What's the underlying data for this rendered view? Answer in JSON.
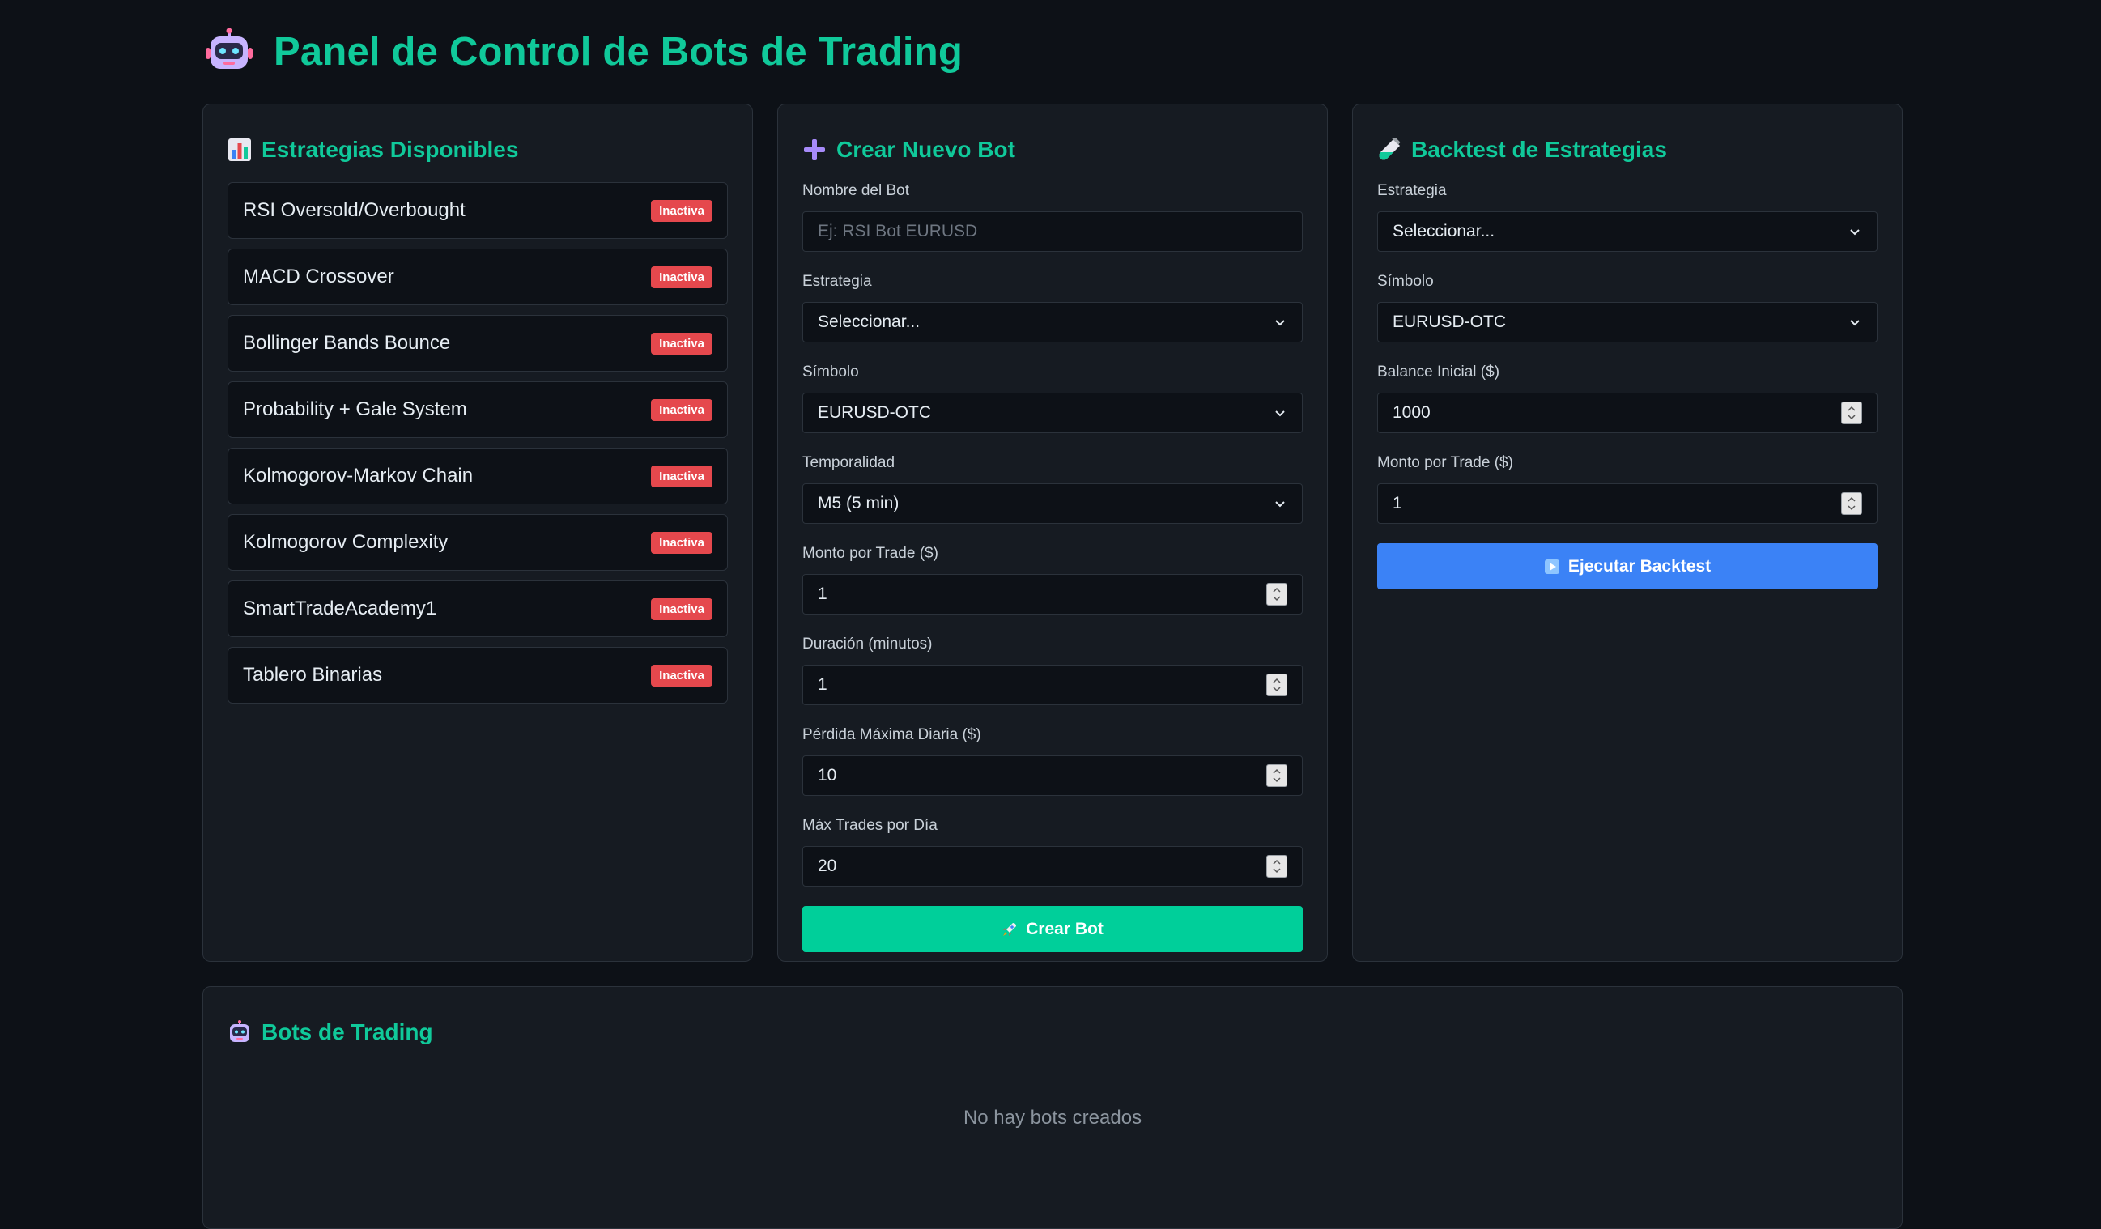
{
  "header": {
    "title": "Panel de Control de Bots de Trading",
    "icon": "robot-icon"
  },
  "strategies": {
    "title": "Estrategias Disponibles",
    "icon": "bar-chart-icon",
    "items": [
      {
        "name": "RSI Oversold/Overbought",
        "status": "Inactiva"
      },
      {
        "name": "MACD Crossover",
        "status": "Inactiva"
      },
      {
        "name": "Bollinger Bands Bounce",
        "status": "Inactiva"
      },
      {
        "name": "Probability + Gale System",
        "status": "Inactiva"
      },
      {
        "name": "Kolmogorov-Markov Chain",
        "status": "Inactiva"
      },
      {
        "name": "Kolmogorov Complexity",
        "status": "Inactiva"
      },
      {
        "name": "SmartTradeAcademy1",
        "status": "Inactiva"
      },
      {
        "name": "Tablero Binarias",
        "status": "Inactiva"
      }
    ]
  },
  "create": {
    "title": "Crear Nuevo Bot",
    "icon": "plus-icon",
    "name_label": "Nombre del Bot",
    "name_placeholder": "Ej: RSI Bot EURUSD",
    "strategy_label": "Estrategia",
    "strategy_value": "Seleccionar...",
    "symbol_label": "Símbolo",
    "symbol_value": "EURUSD-OTC",
    "timeframe_label": "Temporalidad",
    "timeframe_value": "M5 (5 min)",
    "amount_label": "Monto por Trade ($)",
    "amount_value": "1",
    "duration_label": "Duración (minutos)",
    "duration_value": "1",
    "maxloss_label": "Pérdida Máxima Diaria ($)",
    "maxloss_value": "10",
    "maxtrades_label": "Máx Trades por Día",
    "maxtrades_value": "20",
    "button_label": "Crear Bot",
    "button_icon": "rocket-icon",
    "button_color": "#00cf9a"
  },
  "backtest": {
    "title": "Backtest de Estrategias",
    "icon": "test-tube-icon",
    "strategy_label": "Estrategia",
    "strategy_value": "Seleccionar...",
    "symbol_label": "Símbolo",
    "symbol_value": "EURUSD-OTC",
    "balance_label": "Balance Inicial ($)",
    "balance_value": "1000",
    "amount_label": "Monto por Trade ($)",
    "amount_value": "1",
    "button_label": "Ejecutar Backtest",
    "button_icon": "play-icon",
    "button_color": "#3b82f6"
  },
  "bots": {
    "title": "Bots de Trading",
    "icon": "robot-icon",
    "empty_text": "No hay bots creados"
  },
  "colors": {
    "background": "#0d1117",
    "card": "#161b22",
    "accent": "#10c99a",
    "badge": "#e5484d"
  }
}
